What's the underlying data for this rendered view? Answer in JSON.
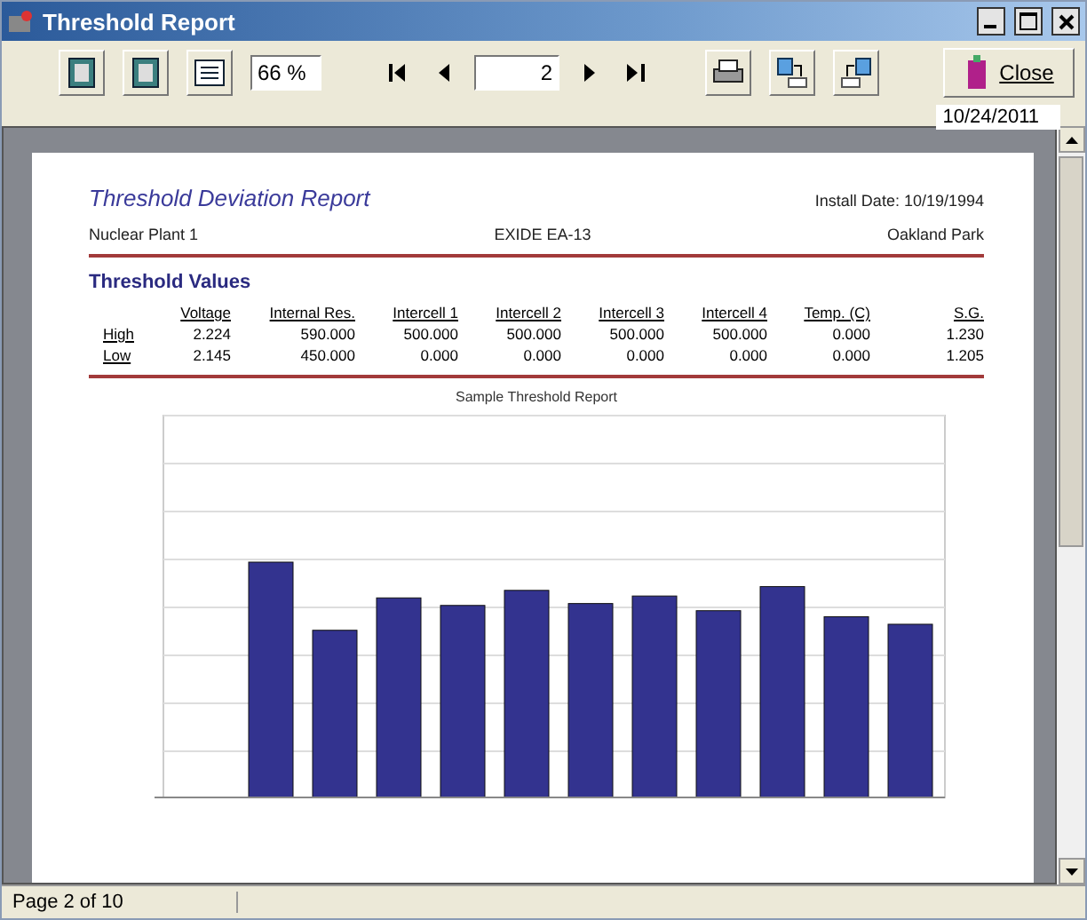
{
  "window": {
    "title": "Threshold Report"
  },
  "toolbar": {
    "zoom": "66 %",
    "page": "2",
    "close_label": "Close",
    "date": "10/24/2011"
  },
  "report": {
    "title": "Threshold Deviation Report",
    "install_date": "Install Date: 10/19/1994",
    "plant": "Nuclear Plant 1",
    "model": "EXIDE EA-13",
    "location": "Oakland Park",
    "section_title": "Threshold Values",
    "columns": [
      "",
      "Voltage",
      "Internal Res.",
      "Intercell 1",
      "Intercell 2",
      "Intercell 3",
      "Intercell 4",
      "Temp. (C)",
      "S.G."
    ],
    "rows": [
      {
        "label": "High",
        "values": [
          "2.224",
          "590.000",
          "500.000",
          "500.000",
          "500.000",
          "500.000",
          "0.000",
          "1.230"
        ]
      },
      {
        "label": "Low",
        "values": [
          "2.145",
          "450.000",
          "0.000",
          "0.000",
          "0.000",
          "0.000",
          "0.000",
          "1.205"
        ]
      }
    ],
    "chart_title": "Sample Threshold Report"
  },
  "status_bar": {
    "text": "Page 2 of 10"
  }
}
